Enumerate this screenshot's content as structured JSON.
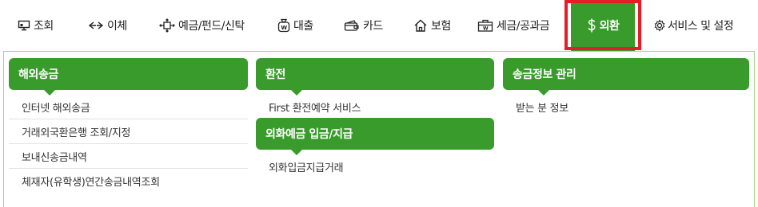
{
  "nav": {
    "items": [
      {
        "label": "조회",
        "icon": "monitor-icon"
      },
      {
        "label": "이체",
        "icon": "transfer-arrows-icon"
      },
      {
        "label": "예금/펀드/신탁",
        "icon": "move-arrows-icon"
      },
      {
        "label": "대출",
        "icon": "loan-bag-icon"
      },
      {
        "label": "카드",
        "icon": "card-wallet-icon"
      },
      {
        "label": "보험",
        "icon": "house-shield-icon"
      },
      {
        "label": "세금/공과금",
        "icon": "tax-briefcase-icon"
      },
      {
        "label": "외환",
        "icon": "dollar-icon"
      },
      {
        "label": "서비스 및 설정",
        "icon": "gear-icon"
      }
    ],
    "active_index": 7
  },
  "menu": {
    "columns": [
      {
        "sections": [
          {
            "title": "해외송금",
            "items": [
              "인터넷 해외송금",
              "거래외국환은행 조회/지정",
              "보내신송금내역",
              "체재자(유학생)연간송금내역조회"
            ]
          }
        ]
      },
      {
        "sections": [
          {
            "title": "환전",
            "items": [
              "First 환전예약 서비스"
            ]
          },
          {
            "title": "외화예금 입금/지급",
            "items": [
              "외화입금지급거래"
            ]
          }
        ]
      },
      {
        "sections": [
          {
            "title": "송금정보 관리",
            "items": [
              "받는 분 정보"
            ]
          }
        ]
      }
    ]
  },
  "colors": {
    "brand_green": "#3a9b2d",
    "highlight_red": "#e41e26",
    "panel_border": "#a8d39a"
  }
}
